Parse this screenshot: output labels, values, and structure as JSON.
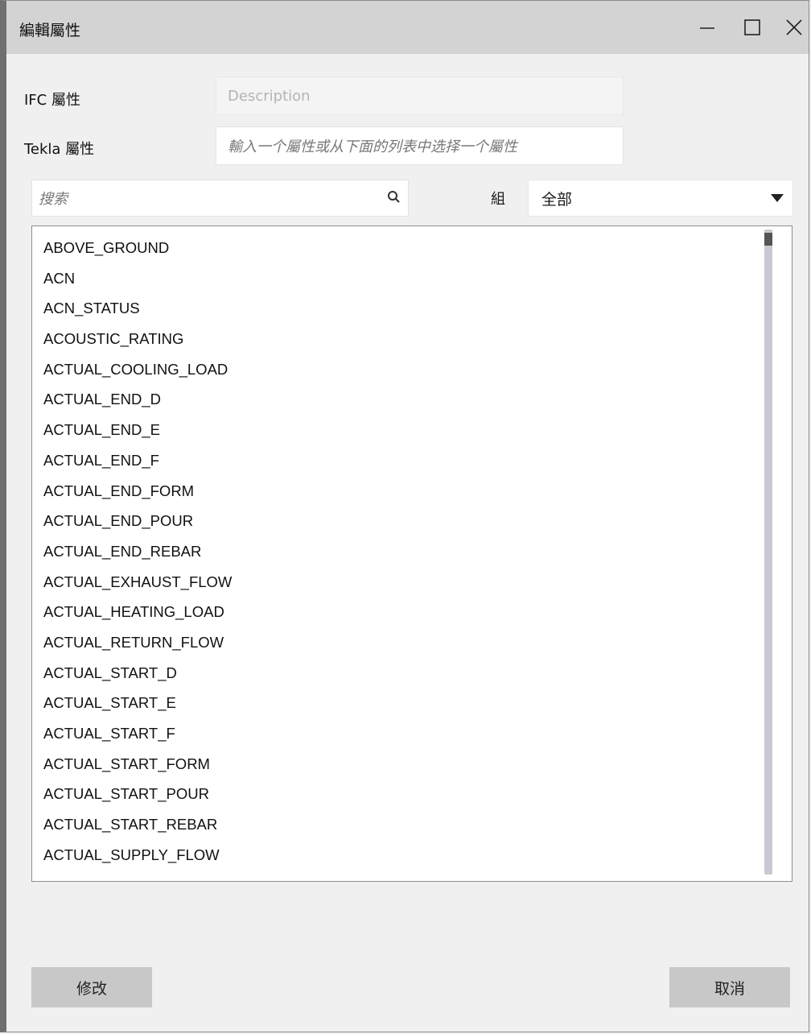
{
  "window": {
    "title": "編輯屬性"
  },
  "form": {
    "ifc_label": "IFC 屬性",
    "ifc_value": "Description",
    "tekla_label": "Tekla 屬性",
    "tekla_placeholder": "輸入一个屬性或从下面的列表中选择一个屬性"
  },
  "search": {
    "placeholder": "搜索"
  },
  "group": {
    "label": "組",
    "selected": "全部"
  },
  "list": {
    "items": [
      "ABOVE_GROUND",
      "ACN",
      "ACN_STATUS",
      "ACOUSTIC_RATING",
      "ACTUAL_COOLING_LOAD",
      "ACTUAL_END_D",
      "ACTUAL_END_E",
      "ACTUAL_END_F",
      "ACTUAL_END_FORM",
      "ACTUAL_END_POUR",
      "ACTUAL_END_REBAR",
      "ACTUAL_EXHAUST_FLOW",
      "ACTUAL_HEATING_LOAD",
      "ACTUAL_RETURN_FLOW",
      "ACTUAL_START_D",
      "ACTUAL_START_E",
      "ACTUAL_START_F",
      "ACTUAL_START_FORM",
      "ACTUAL_START_POUR",
      "ACTUAL_START_REBAR",
      "ACTUAL_SUPPLY_FLOW"
    ]
  },
  "buttons": {
    "modify": "修改",
    "cancel": "取消"
  }
}
